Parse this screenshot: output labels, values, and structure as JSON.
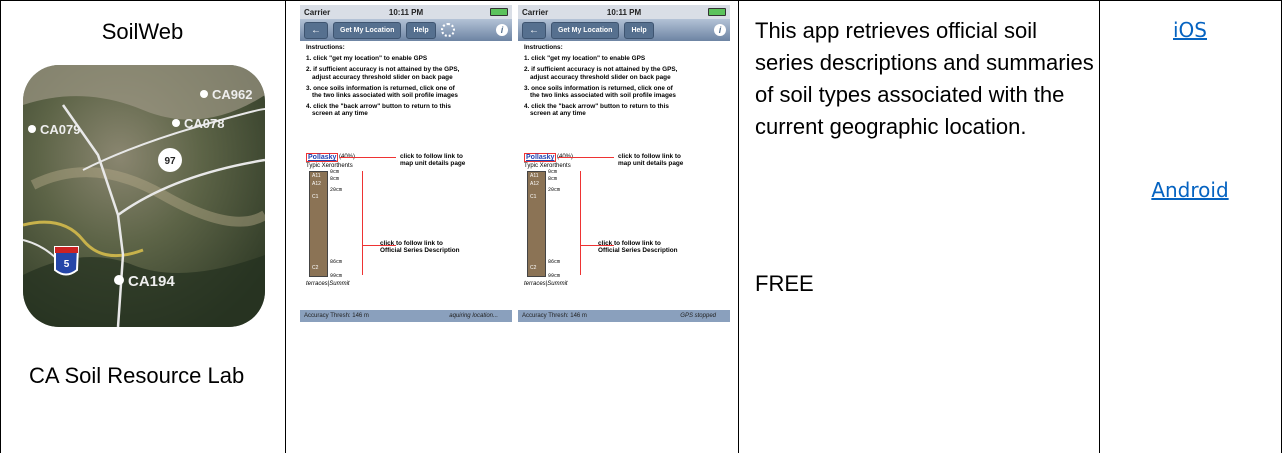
{
  "row": {
    "app_name": "SoilWeb",
    "developer": "CA Soil Resource Lab",
    "description": "This app retrieves official soil series descriptions and summaries of soil types associated with the current geographic location.",
    "price": "FREE",
    "links": {
      "ios": "iOS",
      "android": "Android"
    }
  },
  "icon_labels": {
    "ca962": "CA962",
    "ca078": "CA078",
    "ca079": "CA079",
    "route_97": "97",
    "route_5": "5",
    "ca194": "CA194"
  },
  "screens": [
    {
      "carrier": "Carrier",
      "time": "10:11 PM",
      "nav": {
        "back": "←",
        "location": "Get My Location",
        "help": "Help",
        "info": "i"
      },
      "instructions": {
        "heading": "Instructions:",
        "step1": "1. click \"get my location\" to enable GPS",
        "step2a": "2. if sufficient accuracy is not attained by the GPS,",
        "step2b": "adjust accuracy threshold slider on back page",
        "step3a": "3. once soils information is returned, click one of",
        "step3b": "the two links associated with soil profile images",
        "step4a": "4. click the \"back arrow\" button to return to this",
        "step4b": "screen at any time"
      },
      "profile": {
        "soil": "Pollasky",
        "pct": "(40%)",
        "taxon": "Typic Xerorthents",
        "horizons": [
          "A11",
          "A12",
          "C1",
          "C2"
        ],
        "depths": [
          "0cm",
          "8cm",
          "20cm",
          "86cm",
          "99cm"
        ],
        "landform": "terraces|Summit",
        "note1a": "click to follow link to",
        "note1b": "map unit details page",
        "note2a": "click to follow link to",
        "note2b": "Official Series Description"
      },
      "bottom": {
        "accuracy": "Accuracy Thresh: 146 m",
        "state": "aquiring location..."
      }
    },
    {
      "carrier": "Carrier",
      "time": "10:11 PM",
      "nav": {
        "back": "←",
        "location": "Get My Location",
        "help": "Help",
        "info": "i"
      },
      "instructions": {
        "heading": "Instructions:",
        "step1": "1. click \"get my location\" to enable GPS",
        "step2a": "2. if sufficient accuracy is not attained by the GPS,",
        "step2b": "adjust accuracy threshold slider on back page",
        "step3a": "3. once soils information is returned, click one of",
        "step3b": "the two links associated with soil profile images",
        "step4a": "4. click the \"back arrow\" button to return to this",
        "step4b": "screen at any time"
      },
      "profile": {
        "soil": "Pollasky",
        "pct": "(40%)",
        "taxon": "Typic Xerorthents",
        "horizons": [
          "A11",
          "A12",
          "C1",
          "C2"
        ],
        "depths": [
          "0cm",
          "8cm",
          "20cm",
          "86cm",
          "99cm"
        ],
        "landform": "terraces|Summit",
        "note1a": "click to follow link to",
        "note1b": "map unit details page",
        "note2a": "click to follow link to",
        "note2b": "Official Series Description"
      },
      "bottom": {
        "accuracy": "Accuracy Thresh: 146 m",
        "state": "GPS stopped"
      }
    }
  ]
}
